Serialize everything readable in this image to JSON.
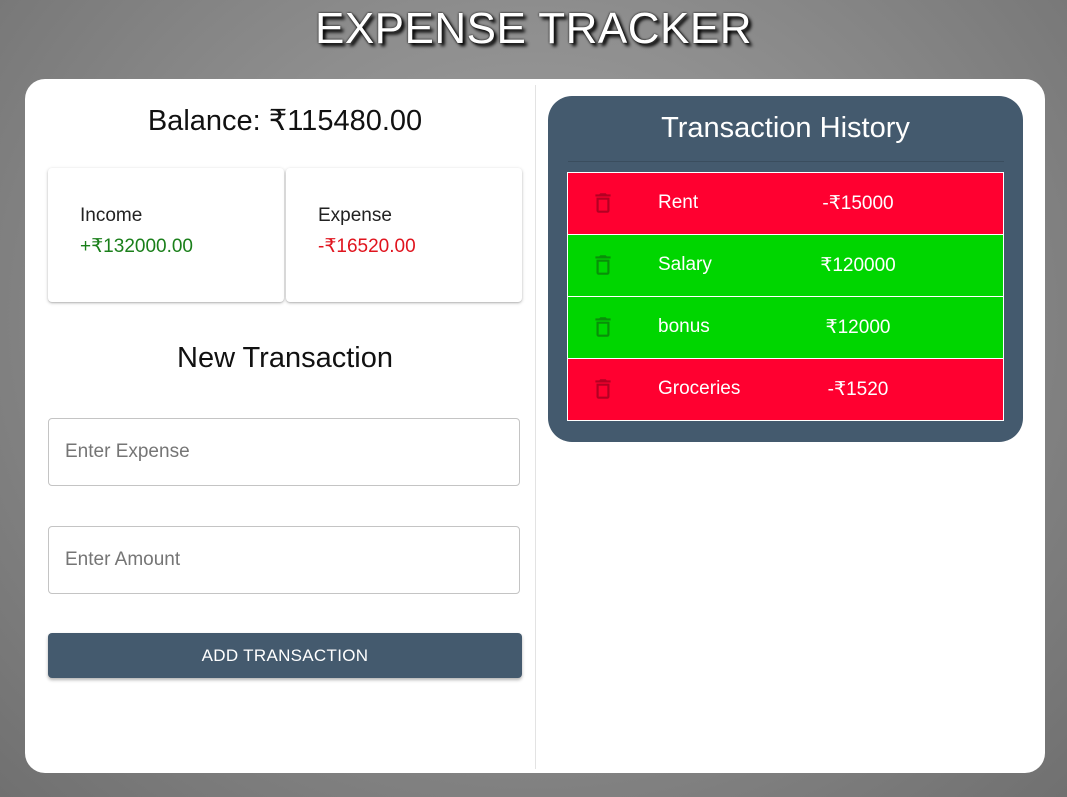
{
  "app": {
    "title": "EXPENSE TRACKER"
  },
  "balance": {
    "text": "Balance: ₹115480.00"
  },
  "summary": {
    "income_label": "Income",
    "income_value": "+₹132000.00",
    "expense_label": "Expense",
    "expense_value": "-₹16520.00"
  },
  "form": {
    "title": "New Transaction",
    "expense_placeholder": "Enter Expense",
    "expense_value": "",
    "amount_placeholder": "Enter Amount",
    "amount_value": "",
    "submit_label": "ADD TRANSACTION"
  },
  "history": {
    "title": "Transaction History",
    "transactions": [
      {
        "name": "Rent",
        "amount": "-₹15000",
        "type": "expense"
      },
      {
        "name": "Salary",
        "amount": "₹120000",
        "type": "income"
      },
      {
        "name": "bonus",
        "amount": "₹12000",
        "type": "income"
      },
      {
        "name": "Groceries",
        "amount": "-₹1520",
        "type": "expense"
      }
    ],
    "delete_icon": "trash-icon"
  },
  "colors": {
    "income_text": "#1a7f1a",
    "expense_text": "#e0141e",
    "income_row": "#00d600",
    "expense_row": "#ff0030",
    "panel": "#445a6e"
  }
}
